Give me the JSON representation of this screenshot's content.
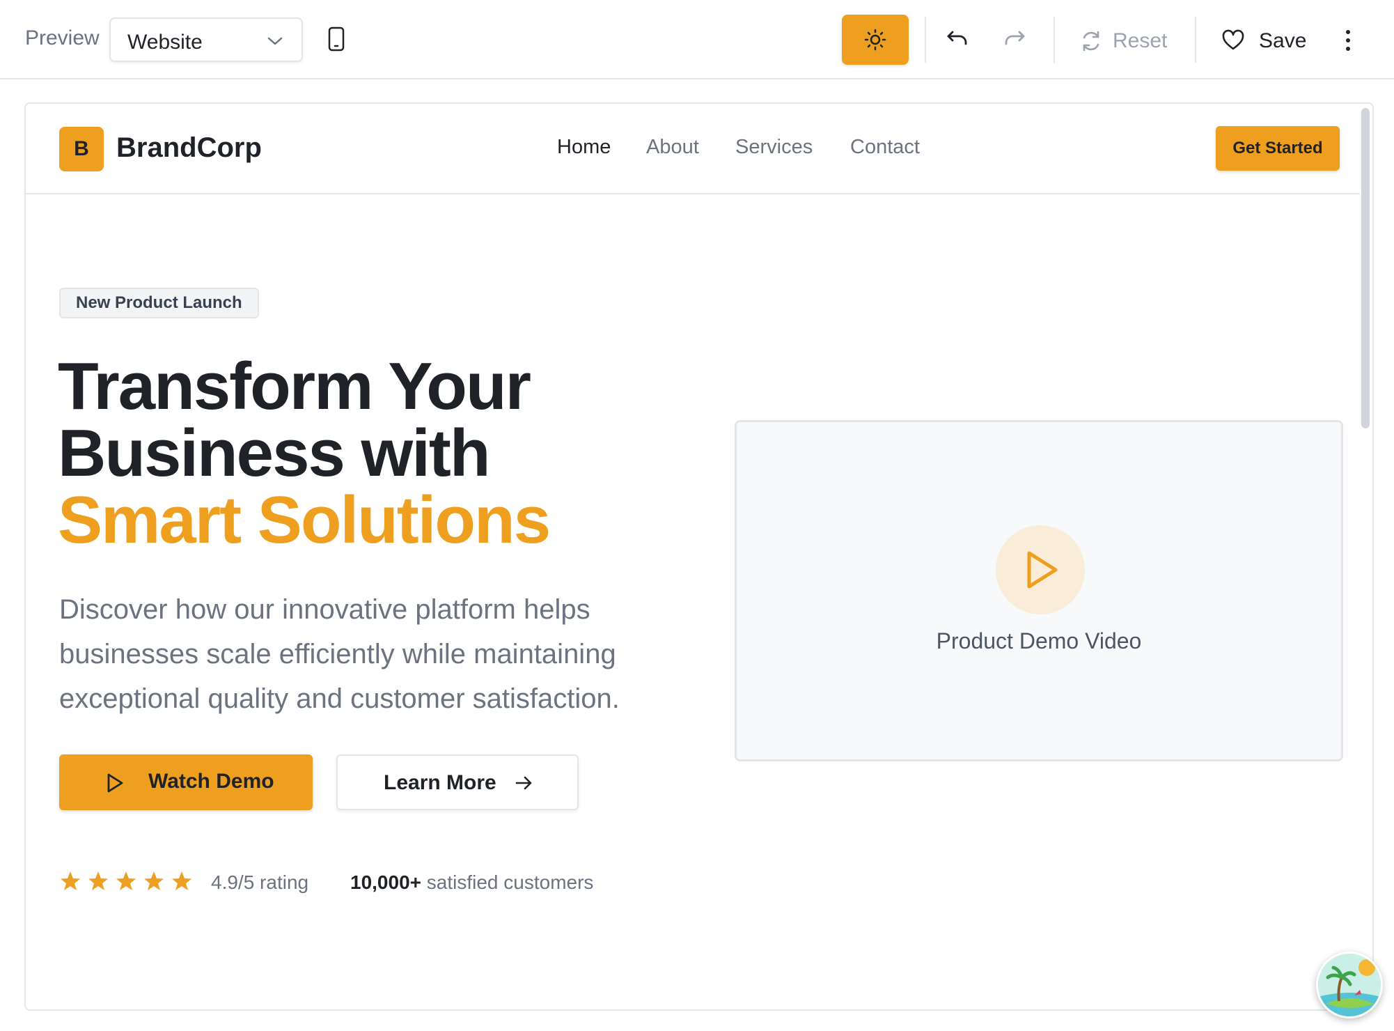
{
  "toolbar": {
    "preview_label": "Preview",
    "view_select": {
      "value": "Website"
    },
    "reset_label": "Reset",
    "save_label": "Save",
    "theme_toggle_icon": "sun-icon",
    "device_icon": "mobile-device-icon",
    "more_icon": "vertical-ellipsis-icon"
  },
  "site": {
    "brand": {
      "logo_letter": "B",
      "name": "BrandCorp"
    },
    "nav": [
      {
        "label": "Home",
        "active": true
      },
      {
        "label": "About",
        "active": false
      },
      {
        "label": "Services",
        "active": false
      },
      {
        "label": "Contact",
        "active": false
      }
    ],
    "cta_label": "Get Started",
    "hero": {
      "badge": "New Product Launch",
      "title_line1": "Transform Your",
      "title_line2": "Business with",
      "title_accent": "Smart Solutions",
      "description": "Discover how our innovative platform helps businesses scale efficiently while maintaining exceptional quality and customer satisfaction.",
      "primary_button": "Watch Demo",
      "secondary_button": "Learn More",
      "rating": {
        "stars": 5,
        "text": "4.9/5 rating"
      },
      "customers": {
        "count": "10,000+",
        "text": "satisfied customers"
      }
    },
    "video": {
      "label": "Product Demo Video"
    }
  },
  "colors": {
    "accent": "#ef9f1f",
    "text_dark": "#1f2328",
    "text_muted": "#6b7280",
    "border": "#e5e7eb"
  }
}
